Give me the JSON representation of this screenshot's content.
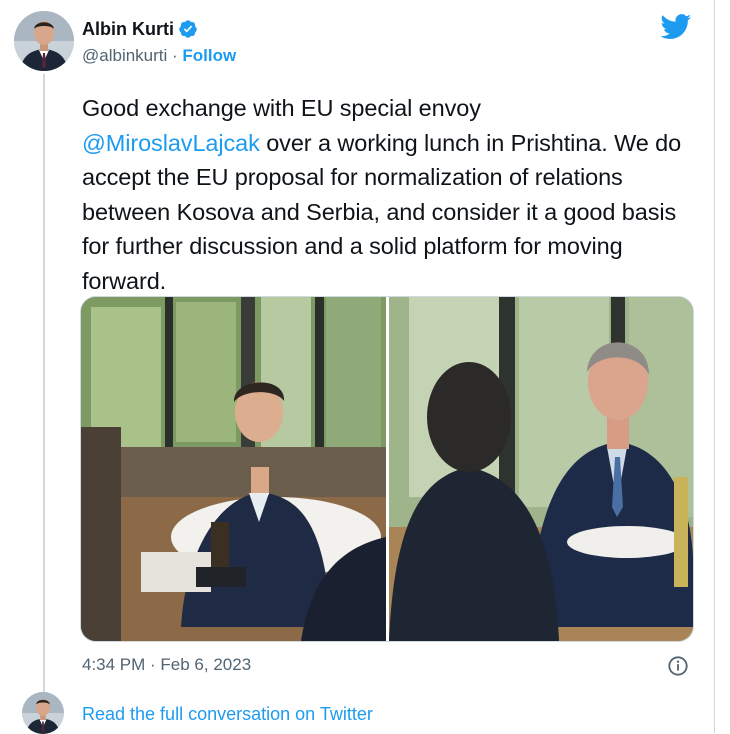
{
  "author": {
    "display_name": "Albin Kurti",
    "handle": "@albinkurti",
    "separator": " · ",
    "follow_label": "Follow",
    "verified_icon": "verified-badge-icon",
    "brand_icon": "twitter-bird-icon"
  },
  "tweet": {
    "text_line1": "Good exchange with EU special envoy",
    "mention": "@MiroslavLajcak",
    "text_rest": " over a working lunch in Prishtina. We do accept the EU proposal for normalization of relations between Kosova and Serbia, and consider it a good basis for further discussion and a solid platform for moving forward."
  },
  "media": {
    "photo_count": 2
  },
  "meta": {
    "timestamp": "4:34 PM · Feb 6, 2023",
    "info_icon": "info-icon"
  },
  "footer": {
    "read_link": "Read the full conversation on Twitter"
  },
  "colors": {
    "accent": "#1d9bf0",
    "text": "#0f1419",
    "secondary": "#536471",
    "border": "#cfd9de"
  }
}
